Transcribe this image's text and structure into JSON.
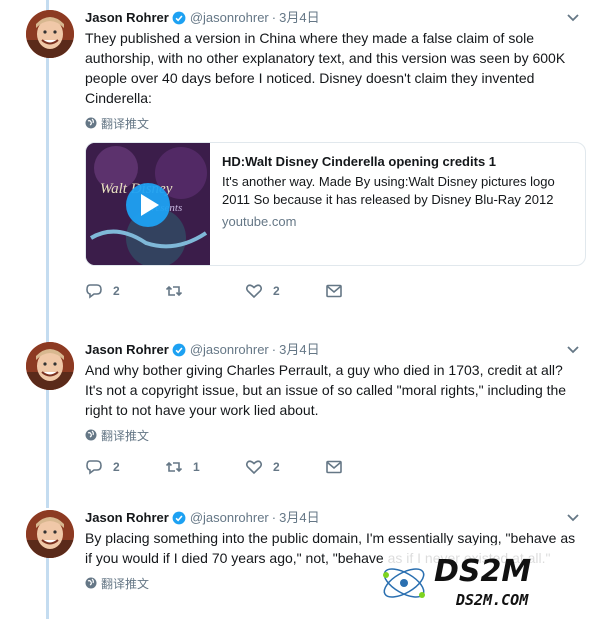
{
  "colors": {
    "link": "#1da1f2",
    "muted": "#657786",
    "thread": "#c4dcf0",
    "text": "#14171a"
  },
  "tweets": [
    {
      "name": "Jason Rohrer",
      "handle": "@jasonrohrer",
      "time": "3月4日",
      "text": "They published a version in China where they made a false claim of sole authorship, with no other explanatory text, and this version was seen by 600K people over 40 days before I noticed.  Disney doesn't claim they invented Cinderella:",
      "translate": "翻译推文",
      "card": {
        "title": "HD:Walt Disney Cinderella opening credits 1",
        "description": "It's another way. Made By using:Walt Disney pictures logo 2011 So because it has released by Disney Blu-Ray 2012",
        "domain": "youtube.com"
      },
      "actions": {
        "replies": "2",
        "retweets": "",
        "likes": "2"
      }
    },
    {
      "name": "Jason Rohrer",
      "handle": "@jasonrohrer",
      "time": "3月4日",
      "text": "And why bother giving Charles Perrault, a guy who died in 1703, credit at all?  It's not a copyright issue, but an issue of so called \"moral rights,\" including the right to not have your work lied about.",
      "translate": "翻译推文",
      "actions": {
        "replies": "2",
        "retweets": "1",
        "likes": "2"
      }
    },
    {
      "name": "Jason Rohrer",
      "handle": "@jasonrohrer",
      "time": "3月4日",
      "text": "By placing something into the public domain, I'm essentially saying, \"behave as if you would if I died 70 years ago,\" not, \"behave as if I never existed at all.\"",
      "translate": "翻译推文"
    }
  ],
  "watermark": {
    "main": "DS2M",
    "sub": "DS2M.COM"
  }
}
